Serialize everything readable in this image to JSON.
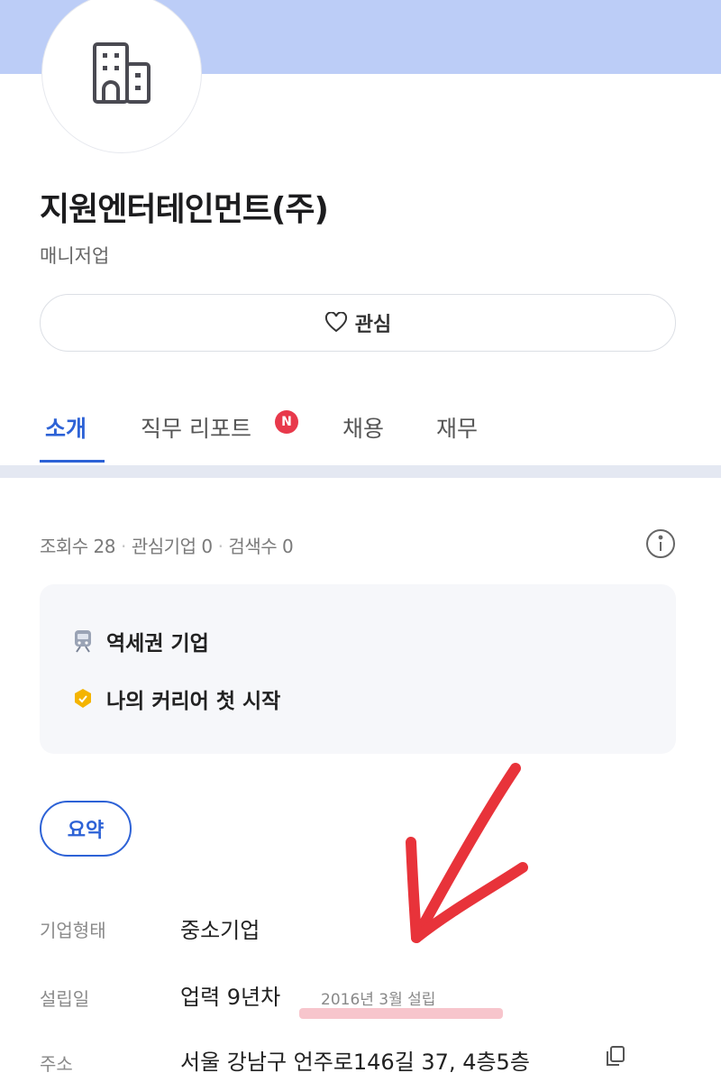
{
  "company": {
    "name": "지원엔터테인먼트(주)",
    "subtitle": "매니저업",
    "logo_icon": "building-icon"
  },
  "follow_button": {
    "label": "관심",
    "icon": "heart-outline-icon"
  },
  "tabs": [
    {
      "label": "소개",
      "active": true
    },
    {
      "label": "직무 리포트",
      "badge": "N"
    },
    {
      "label": "채용"
    },
    {
      "label": "재무"
    }
  ],
  "stats": {
    "views": "조회수 28",
    "interested": "관심기업 0",
    "searches": "검색수 0"
  },
  "highlights": [
    {
      "label": "역세권 기업",
      "icon": "train-icon"
    },
    {
      "label": "나의 커리어 첫 시작",
      "icon": "badge-icon"
    }
  ],
  "summary_pill": "요약",
  "details": {
    "type": {
      "label": "기업형태",
      "value": "중소기업"
    },
    "founded": {
      "label": "설립일",
      "value": "업력 9년차",
      "note": "2016년 3월 설립"
    },
    "address": {
      "label": "주소",
      "value": "서울 강남구 언주로146길 37, 4층5층"
    }
  },
  "colors": {
    "accent": "#2d62d6",
    "banner": "#bccdf7",
    "badge": "#e8394b",
    "annotation": "#e8333a"
  }
}
